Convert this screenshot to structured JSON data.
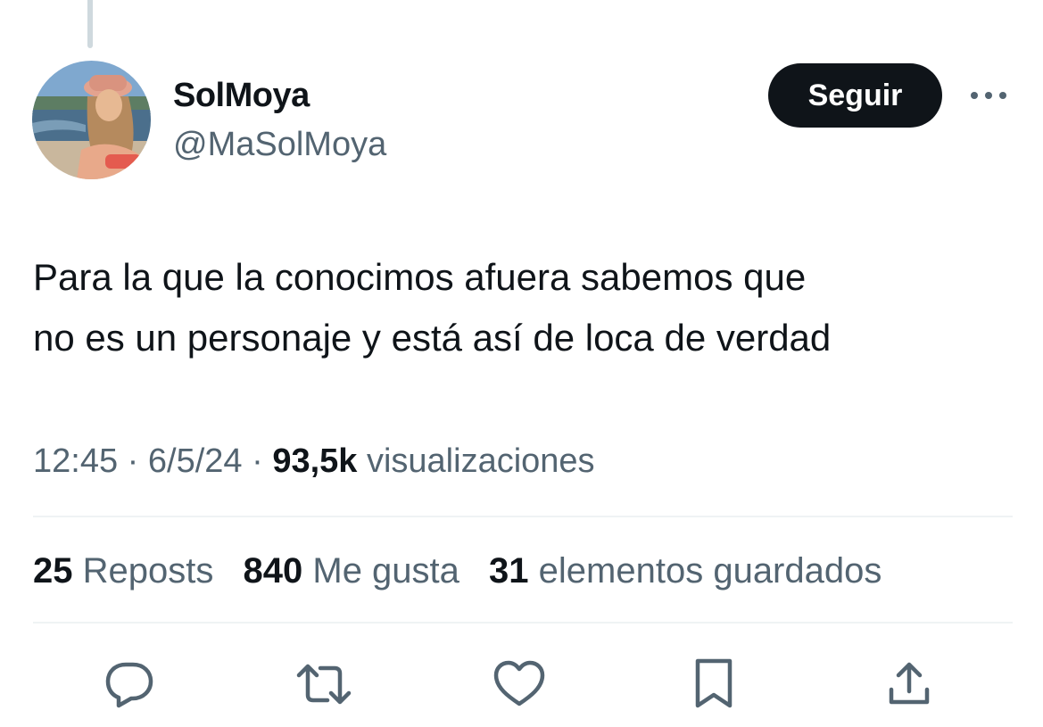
{
  "thread": {
    "connector_color": "#cfd9de"
  },
  "author": {
    "display_name": "SolMoya",
    "handle": "@MaSolMoya",
    "avatar_icon": "profile-photo"
  },
  "header": {
    "follow_label": "Seguir",
    "more_icon": "more-horizontal-icon"
  },
  "tweet": {
    "text_line_1": "Para la que la conocimos afuera sabemos que",
    "text_line_2": "no es un personaje y está así de loca de verdad"
  },
  "meta": {
    "time": "12:45",
    "separator_1": "·",
    "date": "6/5/24",
    "separator_2": "·",
    "views_count": "93,5k",
    "views_label": "visualizaciones"
  },
  "stats": {
    "reposts_count": "25",
    "reposts_label": "Reposts",
    "likes_count": "840",
    "likes_label": "Me gusta",
    "bookmarks_count": "31",
    "bookmarks_label": "elementos guardados"
  },
  "actions": [
    {
      "icon": "reply-icon"
    },
    {
      "icon": "repost-icon"
    },
    {
      "icon": "like-icon"
    },
    {
      "icon": "bookmark-icon"
    },
    {
      "icon": "share-icon"
    }
  ],
  "colors": {
    "text_primary": "#0f1419",
    "text_secondary": "#536471",
    "divider": "#eff3f4",
    "follow_button_bg": "#0f1419",
    "follow_button_text": "#ffffff"
  }
}
